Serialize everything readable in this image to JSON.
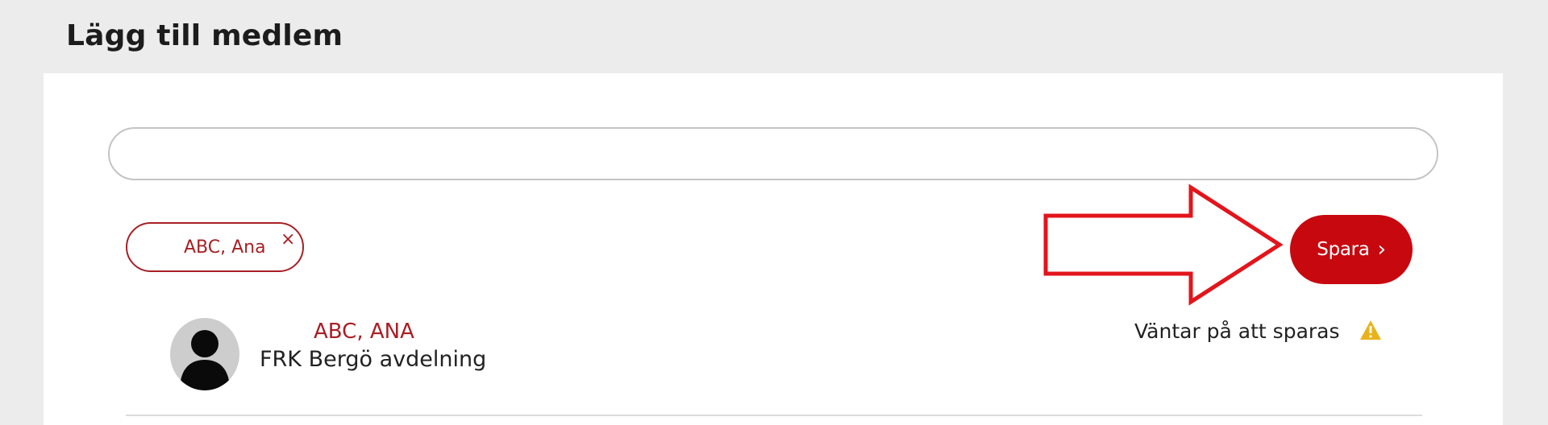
{
  "page": {
    "title": "Lägg till medlem"
  },
  "search": {
    "value": ""
  },
  "selected_chip": {
    "label": "ABC, Ana",
    "remove_glyph": "×"
  },
  "actions": {
    "save_label": "Spara",
    "save_glyph": "›"
  },
  "member": {
    "name": "ABC, ANA",
    "organization": "FRK Bergö avdelning",
    "status": "Väntar på att sparas",
    "status_icon": "warning-icon",
    "avatar_icon": "person-icon"
  },
  "colors": {
    "brand_red": "#c8080f",
    "text_red": "#a81f24",
    "annotation_red": "#e3141b",
    "warning_yellow": "#e8b31a"
  }
}
